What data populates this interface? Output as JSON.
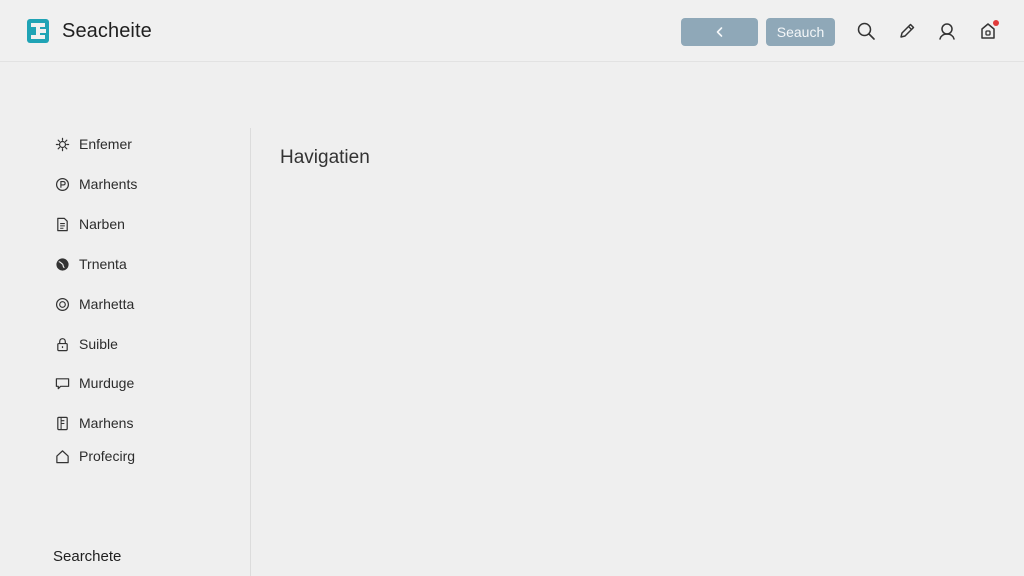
{
  "header": {
    "brand_name": "Seacheite",
    "search_label": "Seauch",
    "icons": [
      "search-icon",
      "pencil-icon",
      "user-icon",
      "notification-icon"
    ],
    "accent_color": "#8fa8b8",
    "notification_color": "#e03a3a"
  },
  "sidebar": {
    "items": [
      {
        "label": "Enfemer",
        "icon": "gear-icon"
      },
      {
        "label": "Marhents",
        "icon": "coin-icon"
      },
      {
        "label": "Narben",
        "icon": "document-icon"
      },
      {
        "label": "Trnenta",
        "icon": "globe-icon"
      },
      {
        "label": "Marhetta",
        "icon": "target-icon"
      },
      {
        "label": "Suible",
        "icon": "lock-icon"
      },
      {
        "label": "Murduge",
        "icon": "message-icon"
      },
      {
        "label": "Marhens",
        "icon": "file-icon"
      },
      {
        "label": "Profecirg",
        "icon": "home-icon"
      }
    ],
    "footer": "Searchete"
  },
  "main": {
    "title": "Havigatien"
  }
}
